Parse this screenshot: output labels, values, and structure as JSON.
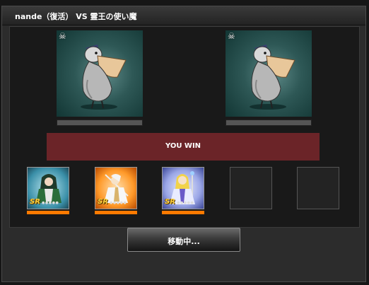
{
  "battle": {
    "title": "nande（復活） VS 霊王の使い魔",
    "result_text": "YOU WIN",
    "status_button": "移動中..."
  },
  "monsters": [
    {
      "name_icon": "pelican-monster-image",
      "marker": "☠",
      "hp_fill": 0
    },
    {
      "name_icon": "pelican-monster-image",
      "marker": "☠",
      "hp_fill": 0
    }
  ],
  "cards": [
    {
      "rarity": "SR",
      "stars": "●●●●●",
      "icon": "green-warrior-card-image",
      "theme": "#2e8aa8"
    },
    {
      "rarity": "SR",
      "stars": "●●●●●",
      "icon": "white-lancer-card-image",
      "theme": "#ff8a1a"
    },
    {
      "rarity": "SR",
      "stars": "●●●●●",
      "icon": "blonde-mage-card-image",
      "theme": "#6a7ad8"
    }
  ],
  "colors": {
    "result_bg": "#6b2428",
    "card_bar": "#ff7a00",
    "monster_bg": "#2e5856"
  }
}
